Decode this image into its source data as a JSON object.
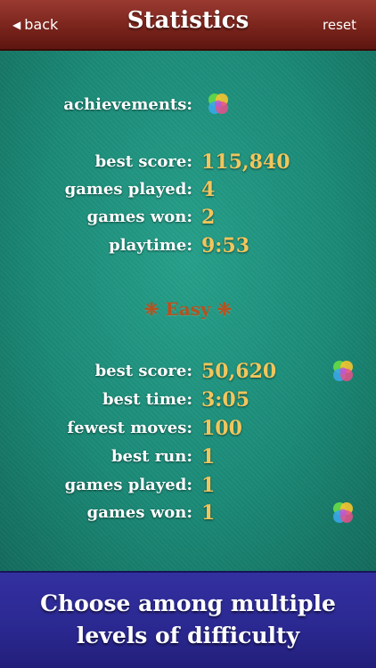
{
  "header": {
    "back_label": "back",
    "title": "Statistics",
    "reset_label": "reset"
  },
  "overall": {
    "achievements_label": "achievements:",
    "best_score_label": "best score:",
    "best_score_value": "115,840",
    "games_played_label": "games played:",
    "games_played_value": "4",
    "games_won_label": "games won:",
    "games_won_value": "2",
    "playtime_label": "playtime:",
    "playtime_value": "9:53"
  },
  "easy": {
    "title": "❈ Easy ❈",
    "best_score_label": "best score:",
    "best_score_value": "50,620",
    "best_time_label": "best time:",
    "best_time_value": "3:05",
    "fewest_moves_label": "fewest moves:",
    "fewest_moves_value": "100",
    "best_run_label": "best run:",
    "best_run_value": "1",
    "games_played_label": "games played:",
    "games_played_value": "1",
    "games_won_label": "games won:",
    "games_won_value": "1"
  },
  "banner": {
    "line1": "Choose among multiple",
    "line2": "levels of difficulty"
  },
  "icons": {
    "back": "back-triangle-icon",
    "achievement": "game-center-icon"
  }
}
